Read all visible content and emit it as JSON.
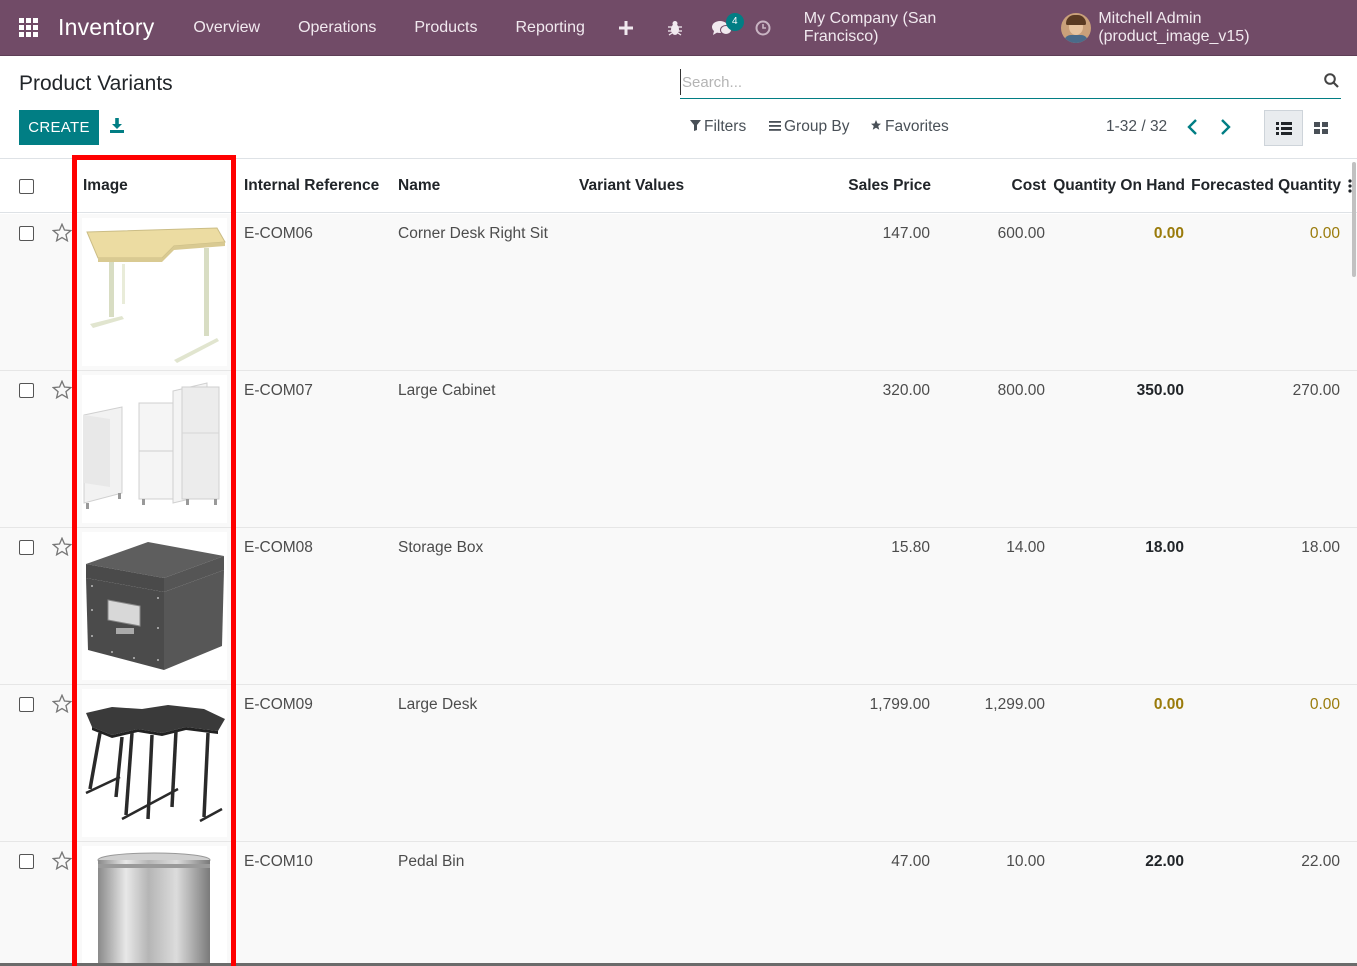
{
  "navbar": {
    "app_title": "Inventory",
    "menu": [
      "Overview",
      "Operations",
      "Products",
      "Reporting"
    ],
    "icons": [
      "plus-icon",
      "bug-icon",
      "chat-icon",
      "clock-icon"
    ],
    "chat_badge": "4",
    "company": "My Company (San Francisco)",
    "user": "Mitchell Admin (product_image_v15)"
  },
  "control_panel": {
    "title": "Product Variants",
    "search_placeholder": "Search...",
    "create_label": "CREATE",
    "filters_label": "Filters",
    "group_by_label": "Group By",
    "favorites_label": "Favorites",
    "pager": "1-32 / 32"
  },
  "table": {
    "columns": [
      "Image",
      "Internal Reference",
      "Name",
      "Variant Values",
      "Sales Price",
      "Cost",
      "Quantity On Hand",
      "Forecasted Quantity"
    ],
    "rows": [
      {
        "image": "corner-desk-image",
        "ref": "E-COM06",
        "name": "Corner Desk Right Sit",
        "variant": "",
        "price": "147.00",
        "cost": "600.00",
        "qty": "0.00",
        "forecast": "0.00"
      },
      {
        "image": "large-cabinet-image",
        "ref": "E-COM07",
        "name": "Large Cabinet",
        "variant": "",
        "price": "320.00",
        "cost": "800.00",
        "qty": "350.00",
        "forecast": "270.00"
      },
      {
        "image": "storage-box-image",
        "ref": "E-COM08",
        "name": "Storage Box",
        "variant": "",
        "price": "15.80",
        "cost": "14.00",
        "qty": "18.00",
        "forecast": "18.00"
      },
      {
        "image": "large-desk-image",
        "ref": "E-COM09",
        "name": "Large Desk",
        "variant": "",
        "price": "1,799.00",
        "cost": "1,299.00",
        "qty": "0.00",
        "forecast": "0.00"
      },
      {
        "image": "pedal-bin-image",
        "ref": "E-COM10",
        "name": "Pedal Bin",
        "variant": "",
        "price": "47.00",
        "cost": "10.00",
        "qty": "22.00",
        "forecast": "22.00"
      }
    ]
  },
  "colors": {
    "navbar": "#714b67",
    "primary": "#017e84",
    "highlight": "#ff0000",
    "warning_text": "#9a7b0b"
  }
}
